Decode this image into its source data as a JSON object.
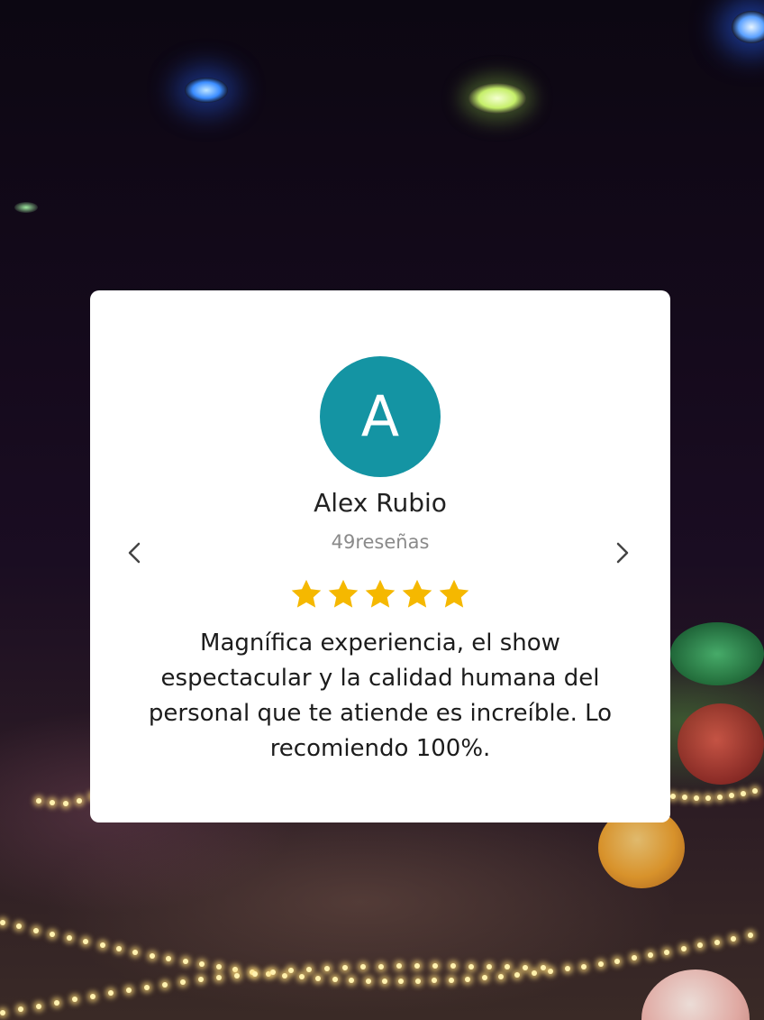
{
  "review": {
    "avatar_initial": "A",
    "reviewer_name": "Alex Rubio",
    "review_count": "49reseñas",
    "rating": 5,
    "rating_max": 5,
    "text": "Magnífica experiencia, el show espectacular y la calidad humana del personal que te atiende es increíble. Lo recomiendo 100%."
  },
  "colors": {
    "avatar_bg": "#1494a3",
    "star": "#f5b800",
    "card_bg": "#ffffff"
  },
  "icons": {
    "prev": "chevron-left-icon",
    "next": "chevron-right-icon",
    "star": "star-icon"
  }
}
